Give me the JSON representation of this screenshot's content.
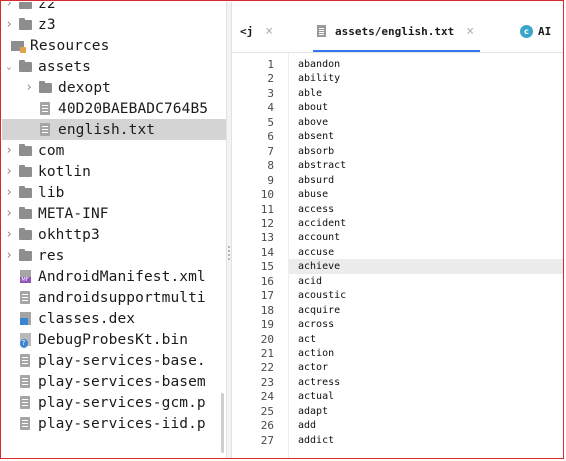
{
  "tree": [
    {
      "label": "z2",
      "kind": "folder",
      "depth": 1,
      "chevron": "collapsed"
    },
    {
      "label": "z3",
      "kind": "folder",
      "depth": 1,
      "chevron": "collapsed"
    },
    {
      "label": "Resources",
      "kind": "folder-res",
      "depth": 0,
      "chevron": "none"
    },
    {
      "label": "assets",
      "kind": "folder",
      "depth": 1,
      "chevron": "expanded"
    },
    {
      "label": "dexopt",
      "kind": "folder",
      "depth": 2,
      "chevron": "collapsed"
    },
    {
      "label": "40D20BAEBADC764B5",
      "kind": "file",
      "depth": 2,
      "chevron": "none"
    },
    {
      "label": "english.txt",
      "kind": "file",
      "depth": 2,
      "chevron": "none",
      "selected": true
    },
    {
      "label": "com",
      "kind": "folder",
      "depth": 1,
      "chevron": "collapsed"
    },
    {
      "label": "kotlin",
      "kind": "folder",
      "depth": 1,
      "chevron": "collapsed"
    },
    {
      "label": "lib",
      "kind": "folder",
      "depth": 1,
      "chevron": "collapsed"
    },
    {
      "label": "META-INF",
      "kind": "folder",
      "depth": 1,
      "chevron": "collapsed"
    },
    {
      "label": "okhttp3",
      "kind": "folder",
      "depth": 1,
      "chevron": "collapsed"
    },
    {
      "label": "res",
      "kind": "folder",
      "depth": 1,
      "chevron": "collapsed"
    },
    {
      "label": "AndroidManifest.xml",
      "kind": "file-mf",
      "depth": 1,
      "chevron": "none"
    },
    {
      "label": "androidsupportmulti",
      "kind": "file",
      "depth": 1,
      "chevron": "none"
    },
    {
      "label": "classes.dex",
      "kind": "file-dex",
      "depth": 1,
      "chevron": "none"
    },
    {
      "label": "DebugProbesKt.bin",
      "kind": "file-bin",
      "depth": 1,
      "chevron": "none"
    },
    {
      "label": "play-services-base.",
      "kind": "file",
      "depth": 1,
      "chevron": "none"
    },
    {
      "label": "play-services-basem",
      "kind": "file",
      "depth": 1,
      "chevron": "none"
    },
    {
      "label": "play-services-gcm.p",
      "kind": "file",
      "depth": 1,
      "chevron": "none"
    },
    {
      "label": "play-services-iid.p",
      "kind": "file",
      "depth": 1,
      "chevron": "none"
    }
  ],
  "tabs": [
    {
      "label": "<j",
      "icon": "",
      "close": "×",
      "active": false
    },
    {
      "label": "assets/english.txt",
      "icon": "text-file-icon",
      "close": "×",
      "active": true
    },
    {
      "label": "AI",
      "icon": "ai-icon",
      "close": "",
      "active": false
    }
  ],
  "editor": {
    "current_line": 15,
    "lines": [
      "abandon",
      "ability",
      "able",
      "about",
      "above",
      "absent",
      "absorb",
      "abstract",
      "absurd",
      "abuse",
      "access",
      "accident",
      "account",
      "accuse",
      "achieve",
      "acid",
      "acoustic",
      "acquire",
      "across",
      "act",
      "action",
      "actor",
      "actress",
      "actual",
      "adapt",
      "add",
      "addict"
    ]
  },
  "colors": {
    "selection": "#d4d4d4",
    "current_line": "#ececec",
    "accent": "#3574f0",
    "frame": "#d62b2b"
  }
}
